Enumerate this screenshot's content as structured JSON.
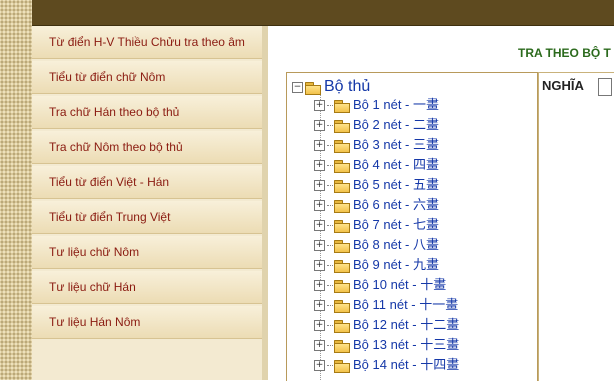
{
  "sidebar": {
    "items": [
      {
        "label": "Từ điển H-V Thiều Chửu tra theo âm"
      },
      {
        "label": "Tiểu từ điển chữ Nôm"
      },
      {
        "label": "Tra chữ Hán theo bộ thủ"
      },
      {
        "label": "Tra chữ Nôm theo bộ thủ"
      },
      {
        "label": "Tiểu từ điển Việt - Hán"
      },
      {
        "label": "Tiểu từ điển Trung Việt"
      },
      {
        "label": "Tư liệu chữ Nôm"
      },
      {
        "label": "Tư liệu chữ Hán"
      },
      {
        "label": "Tư liệu Hán Nôm"
      }
    ]
  },
  "main": {
    "header": "TRA THEO BỘ T",
    "tree": {
      "root_label": "Bộ thủ",
      "root_toggle": "−",
      "item_toggle": "+",
      "items": [
        {
          "label": "Bộ 1 nét - 一畫"
        },
        {
          "label": "Bộ 2 nét - 二畫"
        },
        {
          "label": "Bộ 3 nét - 三畫"
        },
        {
          "label": "Bộ 4 nét - 四畫"
        },
        {
          "label": "Bộ 5 nét - 五畫"
        },
        {
          "label": "Bộ 6 nét - 六畫"
        },
        {
          "label": "Bộ 7 nét - 七畫"
        },
        {
          "label": "Bộ 8 nét - 八畫"
        },
        {
          "label": "Bộ 9 nét - 九畫"
        },
        {
          "label": "Bộ 10 nét - 十畫"
        },
        {
          "label": "Bộ 11 nét - 十一畫"
        },
        {
          "label": "Bộ 12 nét - 十二畫"
        },
        {
          "label": "Bộ 13 nét - 十三畫"
        },
        {
          "label": "Bộ 14 nét - 十四畫"
        }
      ]
    },
    "meaning_label": "NGHĨA"
  }
}
